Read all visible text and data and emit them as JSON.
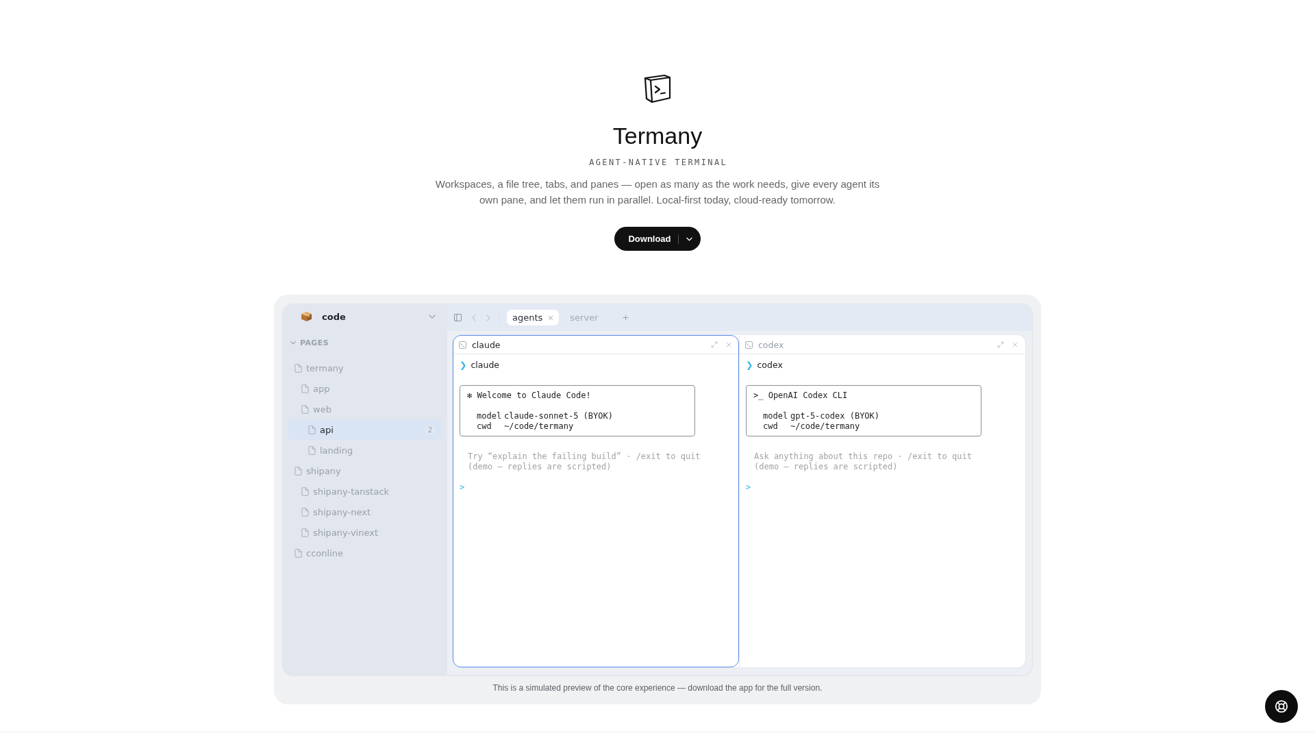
{
  "hero": {
    "title": "Termany",
    "tagline": "AGENT-NATIVE TERMINAL",
    "description": "Workspaces, a file tree, tabs, and panes — open as many as the work needs, give every agent its own pane, and let them run in parallel. Local-first today, cloud-ready tomorrow.",
    "download_button": {
      "label": "Download"
    }
  },
  "preview": {
    "sidebar": {
      "workspace": "code",
      "section": {
        "label": "PAGES",
        "expanded": true
      },
      "items": [
        {
          "label": "termany",
          "selected": false,
          "children": [
            {
              "label": "app",
              "selected": false
            },
            {
              "label": "web",
              "selected": false,
              "children": [
                {
                  "label": "api",
                  "selected": true,
                  "badge": "2"
                },
                {
                  "label": "landing",
                  "selected": false
                }
              ]
            }
          ]
        },
        {
          "label": "shipany",
          "selected": false,
          "children": [
            {
              "label": "shipany-tanstack",
              "selected": false
            },
            {
              "label": "shipany-next",
              "selected": false
            },
            {
              "label": "shipany-vinext",
              "selected": false
            }
          ]
        },
        {
          "label": "cconline",
          "selected": false
        }
      ]
    },
    "tabs": [
      {
        "label": "agents",
        "selected": true
      },
      {
        "label": "server",
        "selected": false
      }
    ],
    "panes": [
      {
        "title": "claude",
        "active": true,
        "prompt_symbol": "❯",
        "command": "claude",
        "banner": {
          "heading": "✻ Welcome to Claude Code!",
          "rows": [
            {
              "key": "model",
              "value": "claude-sonnet-5 (BYOK)"
            },
            {
              "key": "cwd",
              "value": "~/code/termany"
            }
          ]
        },
        "hints": [
          "Try “explain the failing build” · /exit to quit",
          "(demo — replies are scripted)"
        ],
        "input_prompt": ">"
      },
      {
        "title": "codex",
        "active": false,
        "prompt_symbol": "❯",
        "command": "codex",
        "banner": {
          "heading": ">_ OpenAI Codex CLI",
          "rows": [
            {
              "key": "model",
              "value": "gpt-5-codex (BYOK)"
            },
            {
              "key": "cwd",
              "value": "~/code/termany"
            }
          ]
        },
        "hints": [
          "Ask anything about this repo · /exit to quit",
          "(demo — replies are scripted)"
        ],
        "input_prompt": ">"
      }
    ],
    "caption": "This is a simulated preview of the core experience — download the app for the full version."
  }
}
